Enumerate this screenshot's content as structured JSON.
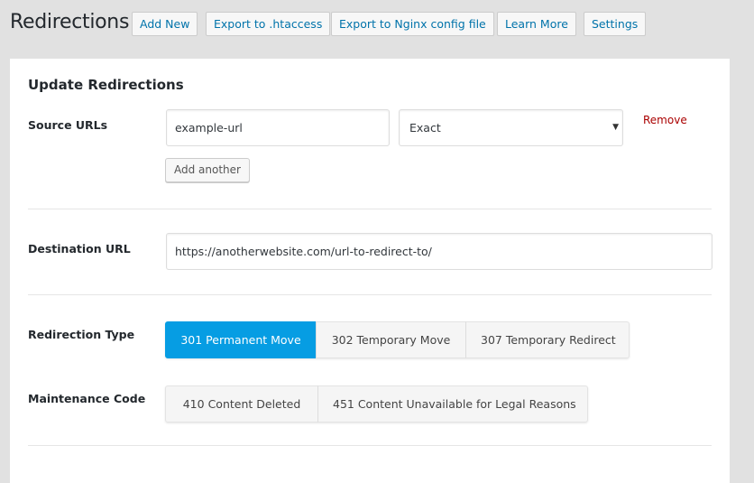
{
  "header": {
    "title": "Redirections",
    "buttons": [
      {
        "label": "Add New"
      },
      {
        "label": "Export to .htaccess"
      },
      {
        "label": "Export to Nginx config file"
      },
      {
        "label": "Learn More"
      },
      {
        "label": "Settings"
      }
    ]
  },
  "form": {
    "section_title": "Update Redirections",
    "source": {
      "label": "Source URLs",
      "value": "example-url",
      "match_type": "Exact",
      "remove_label": "Remove",
      "add_another_label": "Add another"
    },
    "destination": {
      "label": "Destination URL",
      "value": "https://anotherwebsite.com/url-to-redirect-to/"
    },
    "redirection_type": {
      "label": "Redirection Type",
      "options": [
        {
          "label": "301 Permanent Move",
          "active": true
        },
        {
          "label": "302 Temporary Move",
          "active": false
        },
        {
          "label": "307 Temporary Redirect",
          "active": false
        }
      ]
    },
    "maintenance_code": {
      "label": "Maintenance Code",
      "options": [
        {
          "label": "410 Content Deleted",
          "active": false
        },
        {
          "label": "451 Content Unavailable for Legal Reasons",
          "active": false
        }
      ]
    }
  },
  "colors": {
    "accent": "#069de3",
    "link": "#0073aa",
    "danger": "#aa0000",
    "background": "#e1e1e1"
  }
}
